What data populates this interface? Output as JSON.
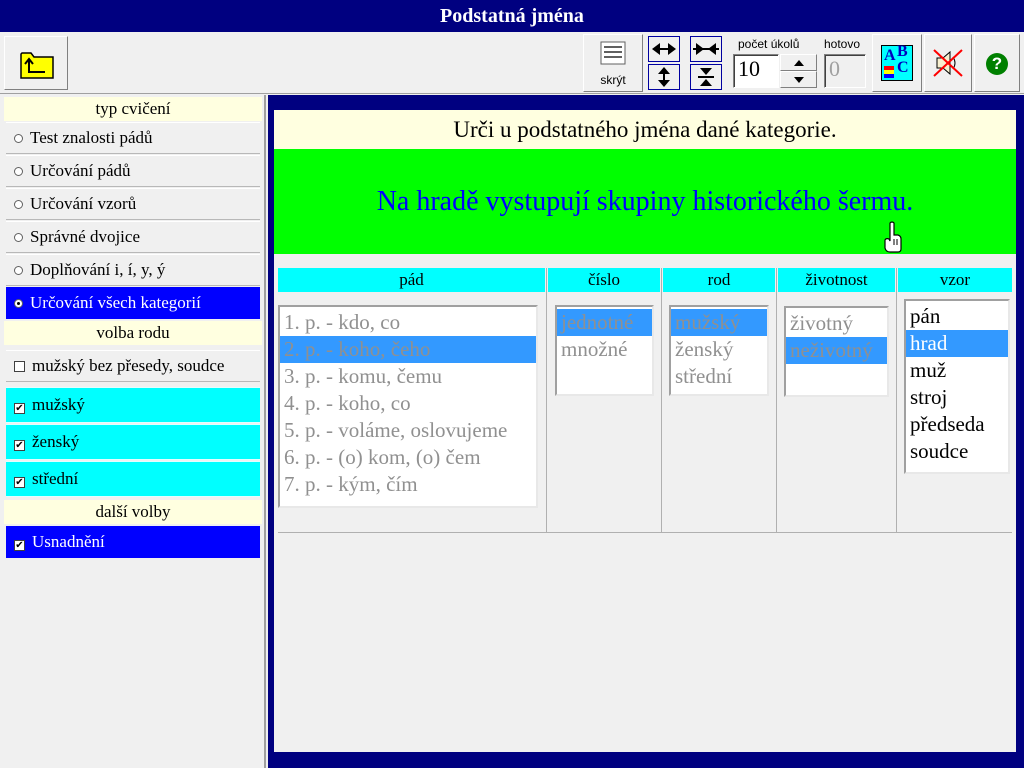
{
  "window": {
    "title": "Podstatná jména"
  },
  "toolbar": {
    "hide_label": "skrýt",
    "task_count_label": "počet úkolů",
    "task_count_value": "10",
    "done_label": "hotovo",
    "done_value": "0",
    "abc_letters": [
      "A",
      "B",
      "C"
    ],
    "help_symbol": "?"
  },
  "sidebar": {
    "exercise_type_header": "typ cvičení",
    "exercise_types": [
      {
        "label": "Test znalosti pádů",
        "selected": false
      },
      {
        "label": "Určování pádů",
        "selected": false
      },
      {
        "label": "Určování vzorů",
        "selected": false
      },
      {
        "label": "Správné dvojice",
        "selected": false
      },
      {
        "label": "Doplňování i, í, y, ý",
        "selected": false
      },
      {
        "label": "Určování všech kategorií",
        "selected": true
      }
    ],
    "gender_header": "volba rodu",
    "gender_options": [
      {
        "label": "mužský bez přesedy, soudce",
        "checked": false
      },
      {
        "label": "mužský",
        "checked": true
      },
      {
        "label": "ženský",
        "checked": true
      },
      {
        "label": "střední",
        "checked": true
      }
    ],
    "other_header": "další volby",
    "other_options": [
      {
        "label": "Usnadnění",
        "checked": true
      }
    ]
  },
  "main": {
    "instruction": "Urči u podstatného jména dané kategorie.",
    "sentence": "Na hradě vystupují skupiny historického šermu.",
    "columns": {
      "case": {
        "header": "pád",
        "items": [
          "1. p. - kdo, co",
          "2. p. - koho, čeho",
          "3. p. - komu, čemu",
          "4. p. - koho, co",
          "5. p. - voláme, oslovujeme",
          "6. p. - (o) kom, (o) čem",
          "7. p. - kým, čím"
        ],
        "selected_index": 1
      },
      "number": {
        "header": "číslo",
        "items": [
          "jednotné",
          "množné"
        ],
        "selected_index": 0
      },
      "gender": {
        "header": "rod",
        "items": [
          "mužský",
          "ženský",
          "střední"
        ],
        "selected_index": 0
      },
      "animacy": {
        "header": "životnost",
        "items": [
          "životný",
          "neživotný"
        ],
        "selected_index": 1
      },
      "pattern": {
        "header": "vzor",
        "items": [
          "pán",
          "hrad",
          "muž",
          "stroj",
          "předseda",
          "soudce"
        ],
        "selected_index": 1
      }
    }
  },
  "colors": {
    "title_bar": "#000080",
    "selection_blue": "#0000ff",
    "list_highlight": "#3399ff",
    "sentence_bg": "#00ff00",
    "sentence_text": "#0000ff",
    "header_cyan": "#00ffff",
    "cream": "#ffffe0"
  }
}
